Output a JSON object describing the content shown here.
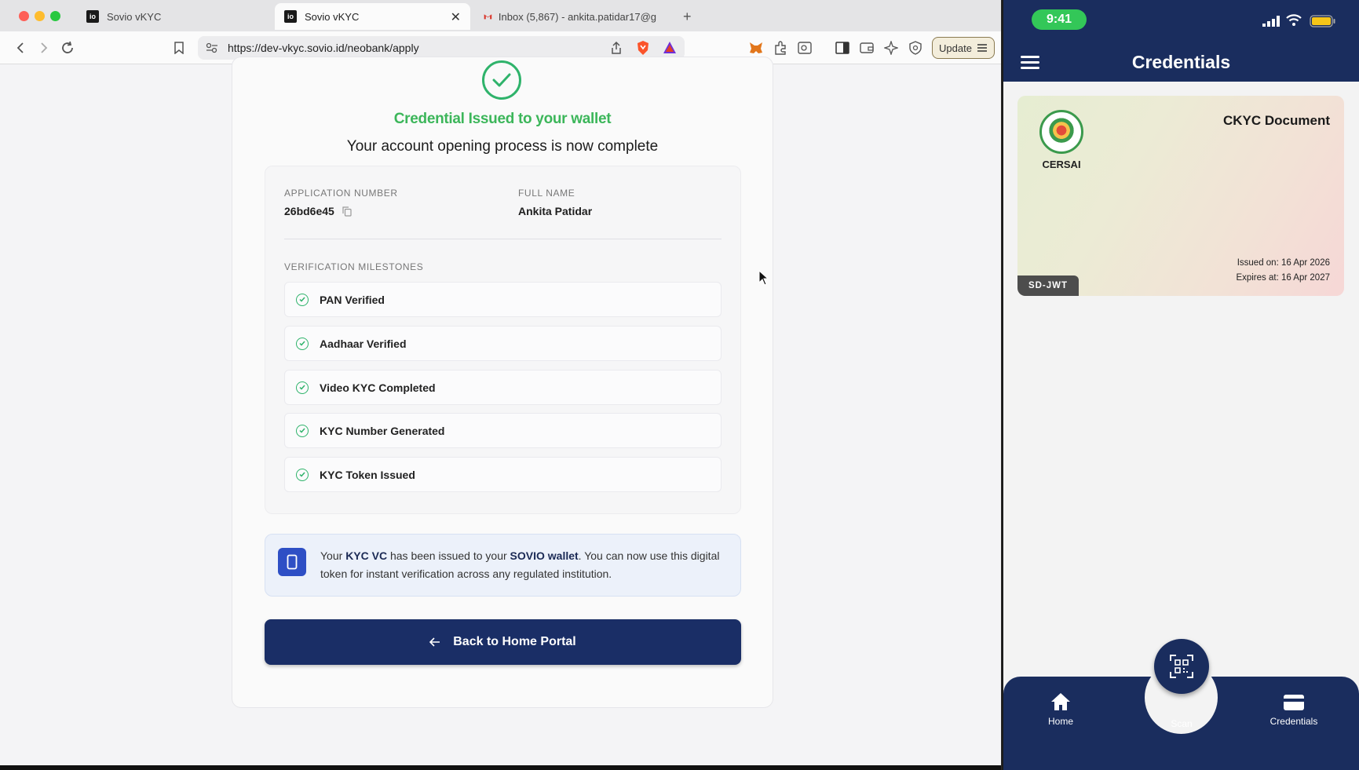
{
  "browser": {
    "tabs": [
      {
        "label": "Sovio vKYC",
        "active": false
      },
      {
        "label": "Sovio vKYC",
        "active": true
      },
      {
        "label": "Inbox (5,867) - ankita.patidar17@g",
        "active": false
      }
    ],
    "url": "https://dev-vkyc.sovio.id/neobank/apply",
    "update_label": "Update"
  },
  "page": {
    "issued_title": "Credential Issued to your wallet",
    "complete_text": "Your account opening process is now complete",
    "application_number_label": "APPLICATION NUMBER",
    "application_number": "26bd6e45",
    "full_name_label": "FULL NAME",
    "full_name": "Ankita Patidar",
    "milestones_label": "VERIFICATION MILESTONES",
    "milestones": [
      "PAN Verified",
      "Aadhaar Verified",
      "Video KYC Completed",
      "KYC Number Generated",
      "KYC Token Issued"
    ],
    "notice": {
      "part1": "Your ",
      "bold1": "KYC VC",
      "part2": " has been issued to your ",
      "bold2": "SOVIO wallet",
      "part3": ". You can now use this digital token for instant verification across any regulated institution."
    },
    "back_button": "Back to Home Portal"
  },
  "phone": {
    "time": "9:41",
    "title": "Credentials",
    "card": {
      "issuer": "CERSAI",
      "document_title": "CKYC Document",
      "issued_on": "Issued on: 16 Apr 2026",
      "expires_at": "Expires at: 16 Apr 2027",
      "format": "SD-JWT"
    },
    "nav": {
      "home": "Home",
      "scan": "Scan",
      "credentials": "Credentials"
    }
  },
  "colors": {
    "success_green": "#3cb65a",
    "navy": "#1a2e66",
    "notice_blue": "#2e4fc5",
    "status_green": "#33c758"
  }
}
